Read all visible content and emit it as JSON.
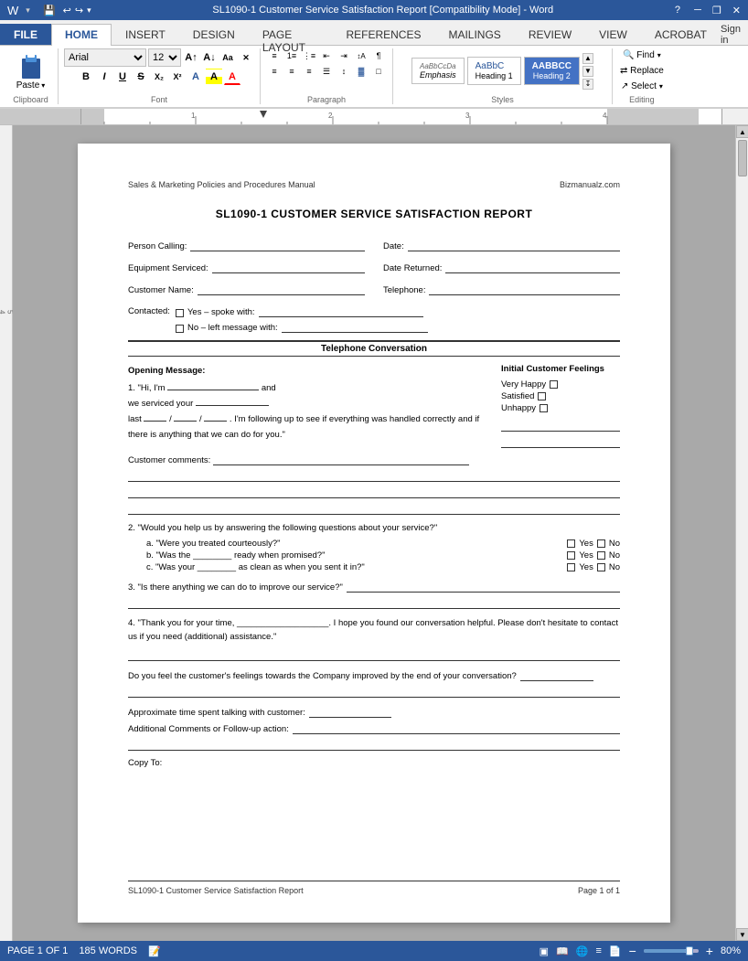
{
  "titleBar": {
    "title": "SL1090-1 Customer Service Satisfaction Report [Compatibility Mode] - Word",
    "buttons": [
      "minimize",
      "restore",
      "close"
    ]
  },
  "quickToolbar": {
    "buttons": [
      "save",
      "undo",
      "redo",
      "customize"
    ]
  },
  "ribbonTabs": [
    {
      "label": "FILE",
      "active": false
    },
    {
      "label": "HOME",
      "active": true
    },
    {
      "label": "INSERT",
      "active": false
    },
    {
      "label": "DESIGN",
      "active": false
    },
    {
      "label": "PAGE LAYOUT",
      "active": false
    },
    {
      "label": "REFERENCES",
      "active": false
    },
    {
      "label": "MAILINGS",
      "active": false
    },
    {
      "label": "REVIEW",
      "active": false
    },
    {
      "label": "VIEW",
      "active": false
    },
    {
      "label": "ACROBAT",
      "active": false
    }
  ],
  "ribbon": {
    "clipboard": {
      "label": "Clipboard"
    },
    "font": {
      "label": "Font",
      "name": "Arial",
      "size": "12",
      "buttons": [
        "B",
        "I",
        "U",
        "S",
        "X₂",
        "X²",
        "A",
        "A"
      ]
    },
    "paragraph": {
      "label": "Paragraph"
    },
    "styles": {
      "label": "Styles",
      "items": [
        {
          "label": "AaBbCcDa",
          "name": "Emphasis",
          "class": "emphasis"
        },
        {
          "label": "AaBbC",
          "name": "Heading 1",
          "class": "heading1"
        },
        {
          "label": "AABBCC",
          "name": "Heading 2",
          "class": "heading2"
        }
      ]
    },
    "editing": {
      "label": "Editing"
    }
  },
  "document": {
    "header": {
      "left": "Sales & Marketing Policies and Procedures Manual",
      "right": "Bizmanualz.com"
    },
    "title": "SL1090-1 CUSTOMER SERVICE SATISFACTION REPORT",
    "fields": {
      "personCalling": "Person Calling:",
      "date": "Date:",
      "equipmentServiced": "Equipment Serviced:",
      "dateReturned": "Date Returned:",
      "customerName": "Customer Name:",
      "telephone": "Telephone:"
    },
    "contacted": {
      "label": "Contacted:",
      "yes": "Yes – spoke with:",
      "no": "No – left message with:"
    },
    "sectionHeader": "Telephone Conversation",
    "openingMessage": {
      "title": "Opening Message:",
      "text1": "1. \"Hi, I'm",
      "text2": "and",
      "text3": "we serviced your",
      "text4": "last",
      "text5": "/",
      "text6": "/",
      "text7": ". I'm following up to see if everything was handled correctly and if there is anything that we can do for you.\""
    },
    "initialFeelings": {
      "title": "Initial Customer Feelings",
      "items": [
        "Very Happy",
        "Satisfied",
        "Unhappy"
      ]
    },
    "customerComments": {
      "label": "Customer comments:"
    },
    "questions": {
      "q2": {
        "text": "2. \"Would you help us by answering the following questions about your service?\"",
        "subs": [
          {
            "label": "a. \"Were you treated courteously?\""
          },
          {
            "label": "b. \"Was the ________ ready when promised?\""
          },
          {
            "label": "c. \"Was your ________ as clean as when you sent it in?\""
          }
        ],
        "options": [
          "Yes",
          "No"
        ]
      },
      "q3": {
        "text": "3. \"Is there anything we can do to improve our service?\""
      },
      "q4": {
        "text": "4. \"Thank you for your time, ___________________. I hope you found our conversation helpful. Please don't hesitate to contact us if you need (additional) assistance.\""
      }
    },
    "doYouFeel": "Do you feel the customer's feelings towards the Company improved by the end of your conversation?",
    "approxTime": "Approximate time spent talking with customer:",
    "additionalComments": "Additional Comments or Follow-up action:",
    "copyTo": "Copy To:",
    "footer": {
      "left": "SL1090-1 Customer Service Satisfaction Report",
      "right": "Page 1 of 1"
    }
  },
  "statusBar": {
    "page": "PAGE 1 OF 1",
    "words": "185 WORDS",
    "zoom": "80%"
  }
}
